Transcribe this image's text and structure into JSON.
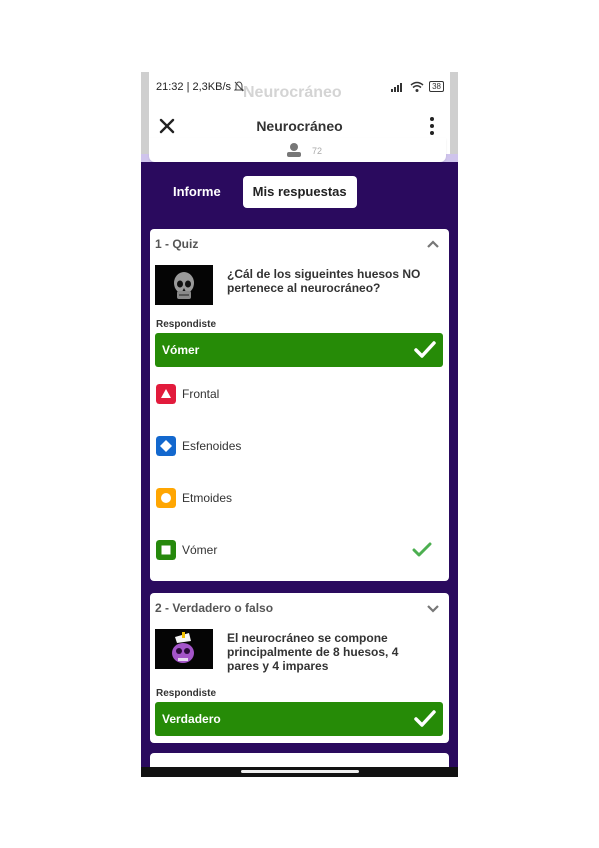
{
  "status_bar": {
    "time_speed": "21:32 | 2,3KB/s",
    "battery": "38",
    "ghost_title": "Neurocráneo"
  },
  "app_bar": {
    "title": "Neurocráneo"
  },
  "sub_bar": {
    "count": "72",
    "icon": "person-icon"
  },
  "tabs": [
    {
      "label": "Informe",
      "active": false
    },
    {
      "label": "Mis respuestas",
      "active": true
    }
  ],
  "questions": [
    {
      "header": "1 - Quiz",
      "question": "¿Cál de los sigueintes huesos NO pertenece al neurocráneo?",
      "responded_label": "Respondiste",
      "answer": "Vómer",
      "options": [
        {
          "label": "Frontal",
          "shape": "triangle",
          "color": "#e21b3c",
          "correct": false
        },
        {
          "label": "Esfenoides",
          "shape": "diamond",
          "color": "#1368ce",
          "correct": false
        },
        {
          "label": "Etmoides",
          "shape": "circle",
          "color": "#ffa602",
          "correct": false
        },
        {
          "label": "Vómer",
          "shape": "square",
          "color": "#26890c",
          "correct": true
        }
      ]
    },
    {
      "header": "2 - Verdadero o falso",
      "question": "El neurocráneo se compone principalmente de 8 huesos, 4 pares y 4 impares",
      "responded_label": "Respondiste",
      "answer": "Verdadero"
    }
  ],
  "colors": {
    "background": "#2a0a5e",
    "correct_green": "#268b07"
  }
}
